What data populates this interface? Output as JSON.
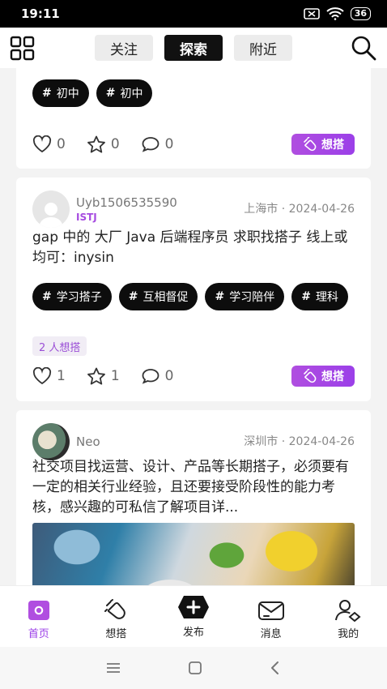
{
  "status_bar": {
    "time": "19:11",
    "battery": "36"
  },
  "header": {
    "tabs": [
      {
        "label": "关注",
        "active": false
      },
      {
        "label": "探索",
        "active": true
      },
      {
        "label": "附近",
        "active": false
      }
    ]
  },
  "feed": {
    "posts": [
      {
        "tags": [
          "初中",
          "初中"
        ],
        "likes": "0",
        "stars": "0",
        "comments": "0",
        "want_label": "想搭"
      },
      {
        "username": "Uyb1506535590",
        "mbti": "ISTJ",
        "location": "上海市",
        "date": "2024-04-26",
        "text": "gap 中的 大厂 Java 后端程序员 求职找搭子 线上或均可：inysin",
        "tags": [
          "学习搭子",
          "互相督促",
          "学习陪伴",
          "理科"
        ],
        "want_count": "2 人想搭",
        "likes": "1",
        "stars": "1",
        "comments": "0",
        "want_label": "想搭"
      },
      {
        "username": "Neo",
        "location": "深圳市",
        "date": "2024-04-26",
        "text": "社交项目找运营、设计、产品等长期搭子，必须要有一定的相关行业经验，且还要接受阶段性的能力考核，感兴趣的可私信了解项目详..."
      }
    ]
  },
  "bottom_nav": {
    "items": [
      {
        "label": "首页",
        "icon": "home-icon",
        "active": true
      },
      {
        "label": "想搭",
        "icon": "clap-icon",
        "active": false
      },
      {
        "label": "发布",
        "icon": "plus-icon",
        "active": false
      },
      {
        "label": "消息",
        "icon": "mail-icon",
        "active": false
      },
      {
        "label": "我的",
        "icon": "profile-icon",
        "active": false
      }
    ]
  },
  "colors": {
    "accent": "#9b3fe8",
    "tag_bg": "#0d0d0d"
  }
}
